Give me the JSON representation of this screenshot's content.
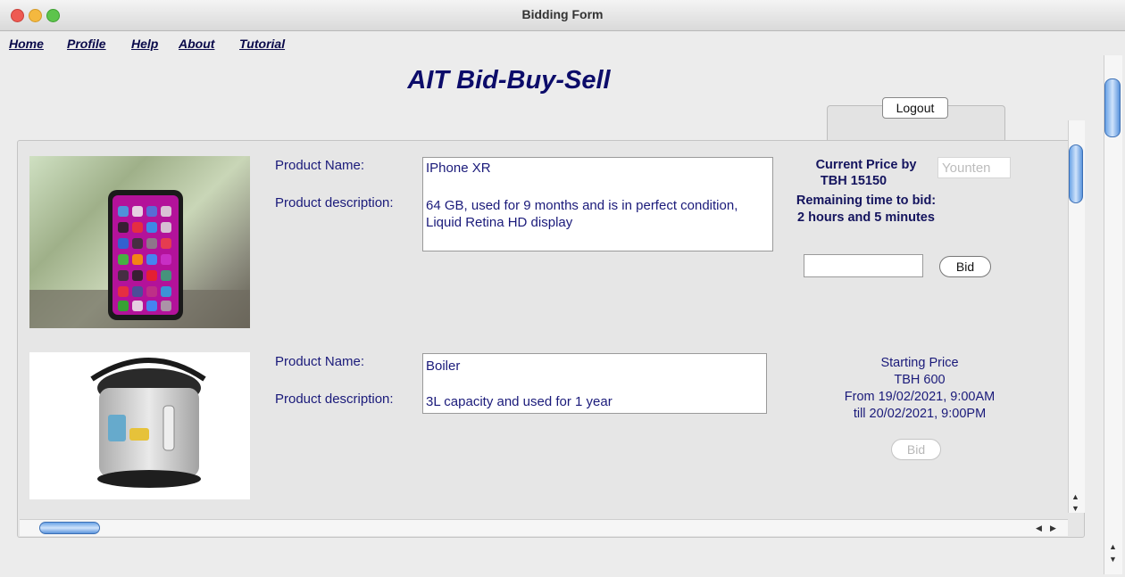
{
  "window": {
    "title": "Bidding Form"
  },
  "menu": [
    {
      "label": "Home"
    },
    {
      "label": "Profile"
    },
    {
      "label": "Help"
    },
    {
      "label": "About"
    },
    {
      "label": "Tutorial"
    }
  ],
  "app_title": "AIT Bid-Buy-Sell",
  "logout_label": "Logout",
  "products": [
    {
      "name_label": "Product Name:",
      "desc_label": "Product description:",
      "name": "IPhone XR",
      "description": "64 GB, used for 9 months and is in perfect condition, Liquid Retina HD display",
      "status_line1": "Current Price by",
      "bidder": "Younten",
      "status_line2": "TBH 15150",
      "status_line3": "Remaining time to bid:",
      "status_line4": "2 hours and 5 minutes",
      "bid_input_value": "",
      "bid_label": "Bid"
    },
    {
      "name_label": "Product Name:",
      "desc_label": "Product description:",
      "name": "Boiler",
      "description": "3L capacity and used for 1 year",
      "status_line1": "Starting Price",
      "status_line2": "TBH 600",
      "status_line3": "From 19/02/2021, 9:00AM",
      "status_line4": "till  20/02/2021, 9:00PM",
      "bid_label": "Bid",
      "bid_enabled": false
    }
  ],
  "colors": {
    "close": "#ee5a52",
    "minimize": "#f4b83f",
    "zoom": "#5dc44c",
    "accent": "#0c0c6a"
  }
}
